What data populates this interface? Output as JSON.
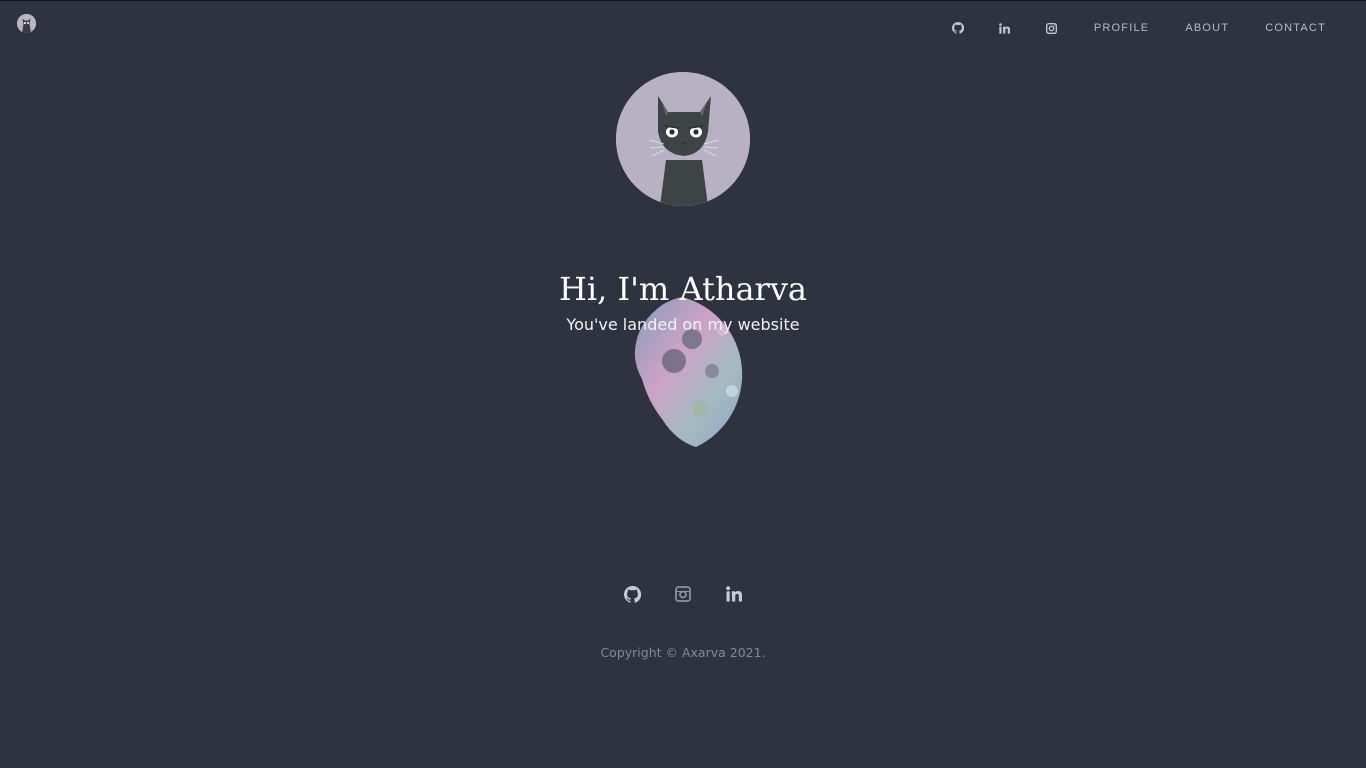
{
  "header": {
    "logo_icon": "cat-logo-icon",
    "social_icons": [
      {
        "name": "github-icon"
      },
      {
        "name": "linkedin-icon"
      },
      {
        "name": "instagram-icon"
      }
    ],
    "nav": [
      {
        "label": "PROFILE"
      },
      {
        "label": "ABOUT"
      },
      {
        "label": "CONTACT"
      }
    ]
  },
  "hero": {
    "avatar_icon": "cat-avatar",
    "title": "Hi, I'm Atharva",
    "subtitle": "You've landed on my website",
    "decoration": "moon-image"
  },
  "footer": {
    "social_icons": [
      {
        "name": "github-icon"
      },
      {
        "name": "instagram-icon"
      },
      {
        "name": "linkedin-icon"
      }
    ],
    "copyright": "Copyright © Axarva 2021."
  },
  "colors": {
    "background": "#2f3340",
    "avatar_bg": "#b8b1c3",
    "nav_text": "#b7bac4",
    "footer_text": "#858894"
  }
}
